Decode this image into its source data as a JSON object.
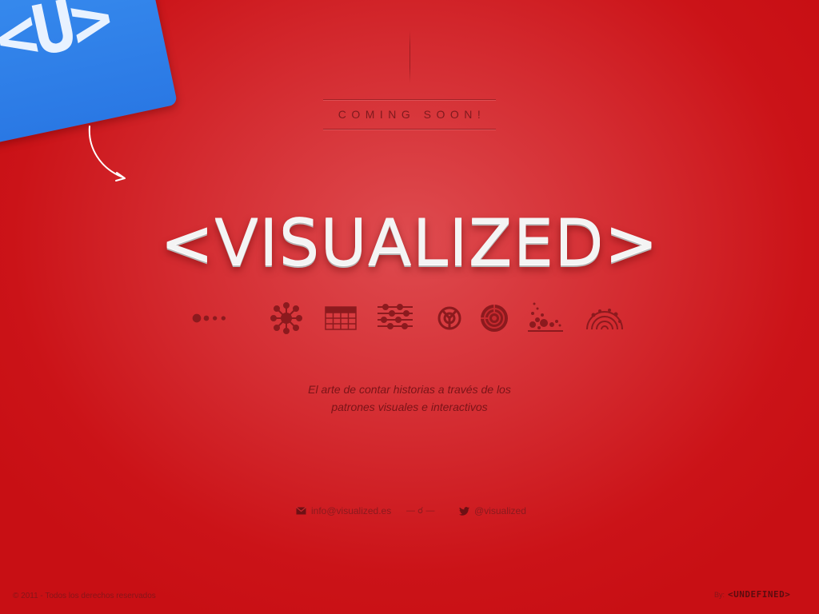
{
  "badge": {
    "text": "<U>"
  },
  "coming_soon": "COMING SOON!",
  "logo": {
    "text": "<VISUALIZED>"
  },
  "icons": [
    "dots-scale-icon",
    "network-icon",
    "grid-table-icon",
    "sliders-icon",
    "radial-icon",
    "circular-target-icon",
    "bubble-scatter-icon",
    "arc-diagram-icon"
  ],
  "tagline": {
    "line1": "El arte de contar historias a través de los",
    "line2": "patrones visuales e interactivos"
  },
  "contact": {
    "email": "info@visualized.es",
    "separator": "— ☌ —",
    "twitter": "@visualized"
  },
  "footer": {
    "copyright": "© 2011 - Todos los derechos reservados",
    "by_label": "By:",
    "by_logo": "<UNDEFINED>"
  },
  "colors": {
    "background": "#cc1a1f",
    "badge": "#2f80e8",
    "logo": "#f4f4f4",
    "icon": "#8c1a1e"
  }
}
